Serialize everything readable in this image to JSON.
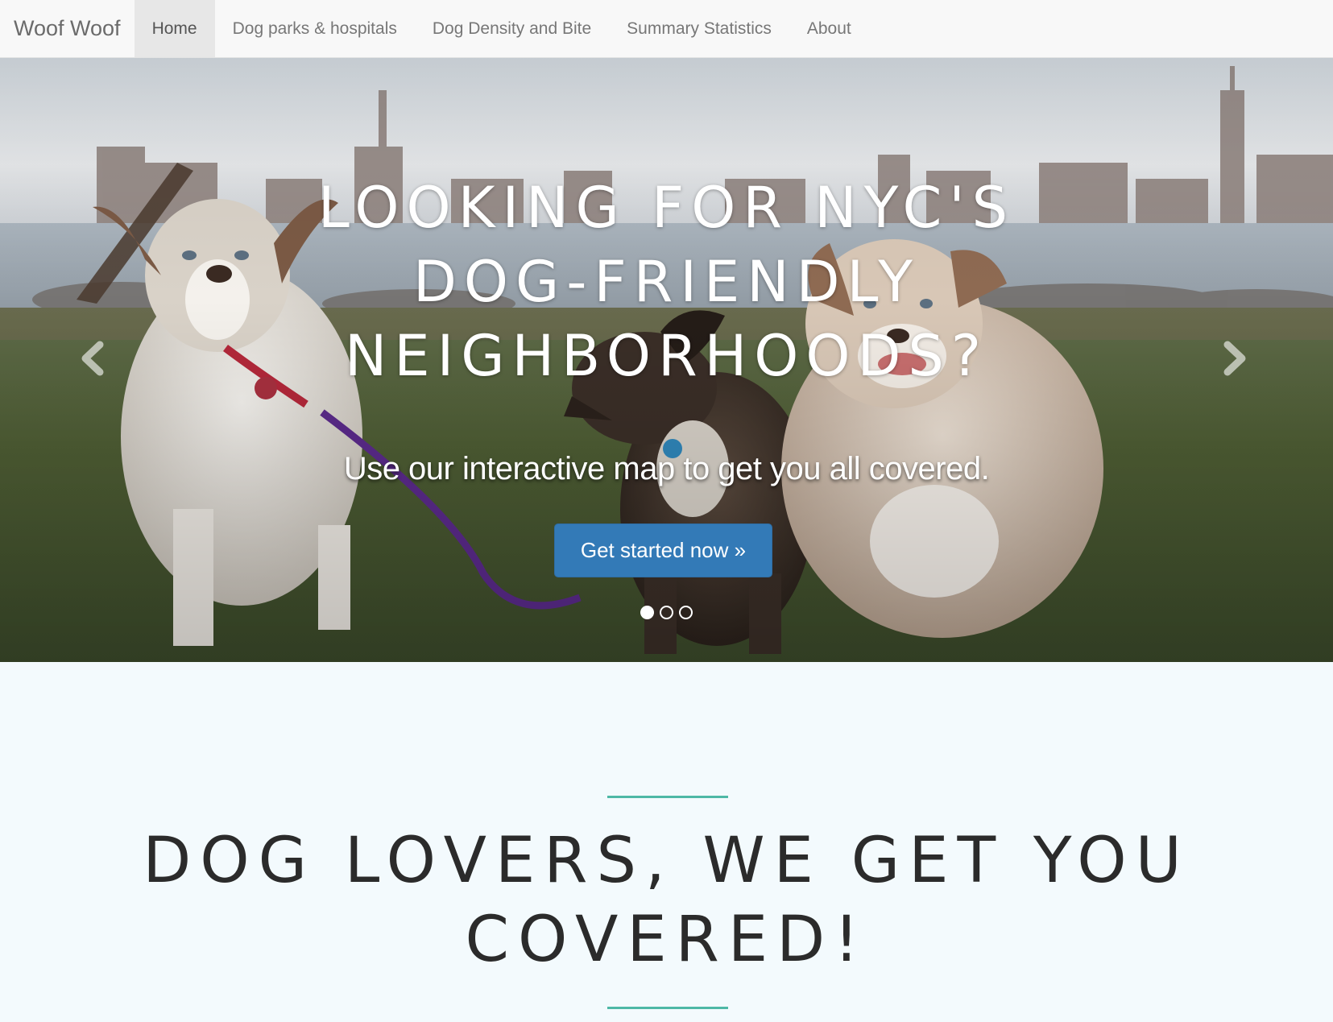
{
  "navbar": {
    "brand": "Woof Woof",
    "items": [
      {
        "label": "Home",
        "active": true
      },
      {
        "label": "Dog parks & hospitals",
        "active": false
      },
      {
        "label": "Dog Density and Bite",
        "active": false
      },
      {
        "label": "Summary Statistics",
        "active": false
      },
      {
        "label": "About",
        "active": false
      }
    ]
  },
  "hero": {
    "title_lines": [
      "LOOKING FOR NYC'S",
      "DOG-FRIENDLY",
      "NEIGHBORHOODS?"
    ],
    "subtitle": "Use our interactive map to get you all covered.",
    "button_label": "Get started now »",
    "prev_icon": "chevron-left-icon",
    "next_icon": "chevron-right-icon",
    "slides": 3,
    "active_slide": 1
  },
  "section": {
    "title_lines": [
      "DOG LOVERS, WE GET YOU",
      "COVERED!"
    ],
    "rule_color": "#4eb8a6"
  },
  "colors": {
    "primary_button": "#337ab7",
    "navbar_bg": "#f8f8f8",
    "section_bg": "#f3fafd"
  }
}
